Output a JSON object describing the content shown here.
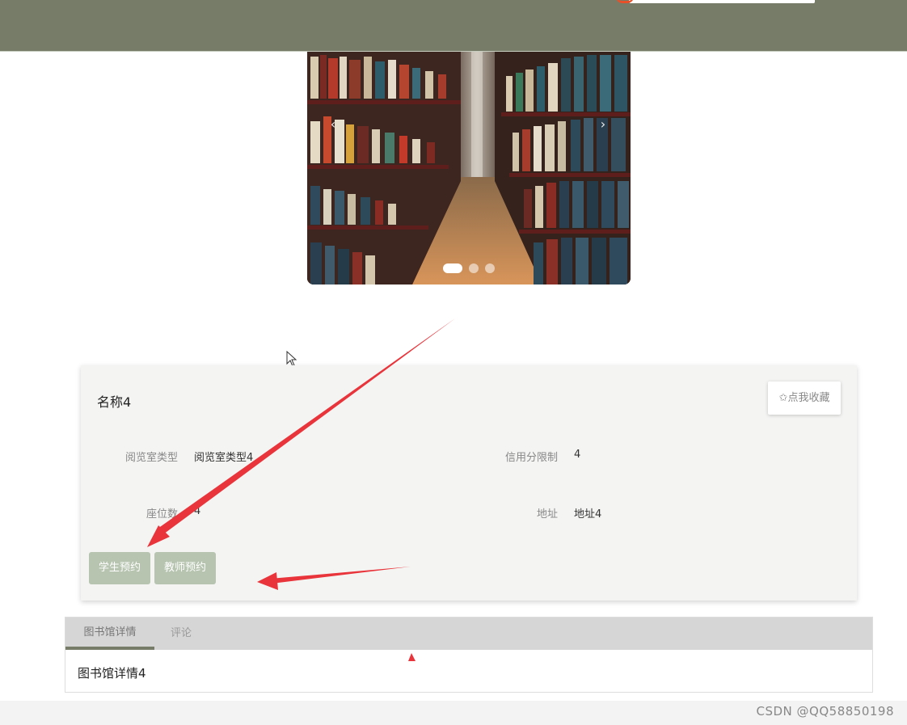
{
  "header": {
    "background_color": "#767c67"
  },
  "carousel": {
    "prev_icon": "chevron-left-icon",
    "next_icon": "chevron-right-icon",
    "prev_glyph": "‹",
    "next_glyph": "›",
    "slide_count": 3,
    "active_slide": 1
  },
  "detail": {
    "title": "名称4",
    "favorite_label": "✩点我收藏",
    "fields": {
      "room_type_label": "阅览室类型",
      "room_type_value": "阅览室类型4",
      "credit_label": "信用分限制",
      "credit_value": "4",
      "seats_label": "座位数",
      "seats_value": "4",
      "address_label": "地址",
      "address_value": "地址4"
    },
    "buttons": {
      "student_reserve": "学生预约",
      "teacher_reserve": "教师预约"
    }
  },
  "tabs": {
    "items": [
      "图书馆详情",
      "评论"
    ],
    "active_index": 0,
    "content": "图书馆详情4"
  },
  "footer": {
    "watermark": "CSDN @QQ58850198"
  },
  "colors": {
    "accent": "#767c67",
    "button": "#b6c4b0",
    "annotation_arrow": "#e8343a"
  }
}
